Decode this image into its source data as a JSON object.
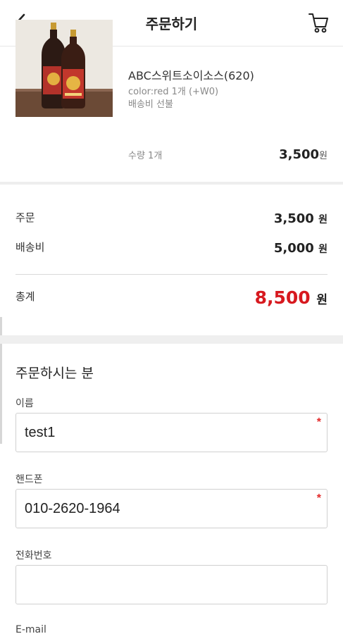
{
  "header": {
    "title": "주문하기",
    "back_icon": "chevron-left-icon",
    "cart_icon": "cart-icon"
  },
  "product": {
    "name": "ABC스위트소이소스(620)",
    "option": "color:red 1개 (+W0)",
    "shipping": "배송비 선불",
    "quantity": "수량 1개",
    "price": "3,500",
    "price_unit": "원"
  },
  "summary": {
    "order_label": "주문",
    "order_value": "3,500",
    "shipping_label": "배송비",
    "shipping_value": "5,000",
    "total_label": "총계",
    "total_value": "8,500",
    "unit": "원",
    "total_color": "#d7191f"
  },
  "orderer": {
    "section_title": "주문하시는 분",
    "name_label": "이름",
    "name_value": "test1",
    "phone_label": "핸드폰",
    "phone_value": "010-2620-1964",
    "tel_label": "전화번호",
    "tel_value": "",
    "email_label": "E-mail",
    "required_mark": "*"
  }
}
